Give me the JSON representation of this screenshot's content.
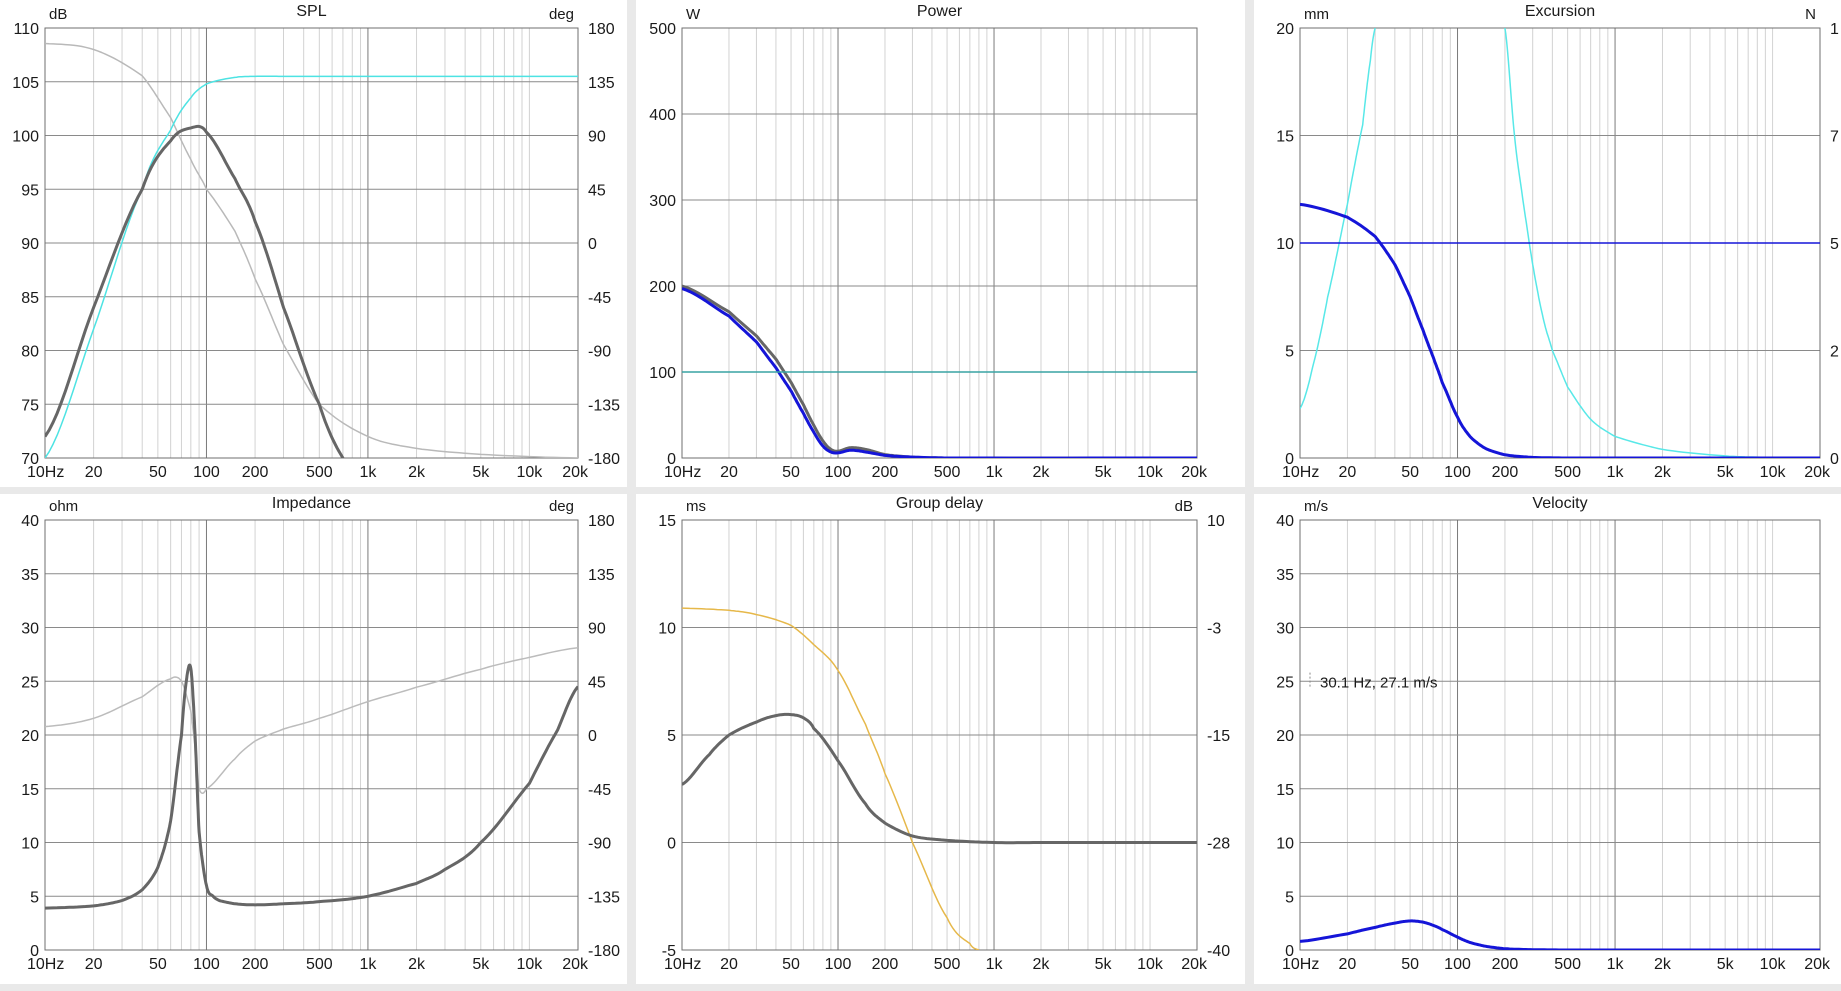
{
  "x_ticks": [
    "10Hz",
    "20",
    "50",
    "100",
    "200",
    "500",
    "1k",
    "2k",
    "5k",
    "10k",
    "20k"
  ],
  "x_range_hz": [
    10,
    20000
  ],
  "chart_data": [
    {
      "id": "spl",
      "type": "line",
      "title": "SPL",
      "left_unit": "dB",
      "right_unit": "deg",
      "ylim": [
        70,
        110
      ],
      "ylim_right": [
        -180,
        180
      ],
      "yticks_left": [
        "70",
        "75",
        "80",
        "85",
        "90",
        "95",
        "100",
        "105",
        "110"
      ],
      "yticks_right": [
        "-180",
        "-135",
        "-90",
        "-45",
        "0",
        "45",
        "90",
        "135",
        "180"
      ],
      "series": [
        {
          "axis": "right",
          "color": "#b9b9b9",
          "x": [
            10,
            20,
            40,
            60,
            80,
            100,
            150,
            200,
            300,
            500,
            1000,
            2000,
            5000,
            20000
          ],
          "y": [
            167,
            162,
            140,
            105,
            70,
            45,
            10,
            -30,
            -85,
            -135,
            -162,
            -172,
            -177,
            -180
          ]
        },
        {
          "axis": "left",
          "color": "#4de3e3",
          "x": [
            10,
            20,
            40,
            60,
            80,
            100,
            150,
            200,
            300,
            500,
            1000,
            5000,
            20000
          ],
          "y": [
            70,
            82,
            95,
            100.5,
            103.5,
            104.8,
            105.4,
            105.5,
            105.5,
            105.5,
            105.5,
            105.5,
            105.5
          ]
        },
        {
          "axis": "left",
          "color": "#666666",
          "x": [
            10,
            20,
            40,
            60,
            80,
            100,
            150,
            200,
            300,
            500,
            700,
            800
          ],
          "y": [
            72,
            84,
            95,
            99.5,
            100.7,
            100.3,
            96,
            92,
            84,
            75,
            70,
            68
          ]
        }
      ]
    },
    {
      "id": "power",
      "type": "line",
      "title": "Power",
      "left_unit": "W",
      "right_unit": "",
      "ylim": [
        0,
        500
      ],
      "yticks_left": [
        "0",
        "100",
        "200",
        "300",
        "400",
        "500"
      ],
      "series": [
        {
          "axis": "left",
          "color": "#666666",
          "x": [
            10,
            20,
            30,
            40,
            50,
            60,
            70,
            80,
            90,
            100,
            120,
            150,
            200,
            300,
            500,
            20000
          ],
          "y": [
            200,
            170,
            142,
            115,
            88,
            62,
            38,
            20,
            10,
            8,
            12,
            10,
            4,
            1,
            0,
            0
          ]
        },
        {
          "axis": "left",
          "color": "#1515d8",
          "x": [
            10,
            20,
            30,
            40,
            50,
            60,
            70,
            80,
            90,
            100,
            120,
            150,
            200,
            300,
            500,
            20000
          ],
          "y": [
            197,
            165,
            135,
            105,
            78,
            52,
            30,
            14,
            7,
            6,
            9,
            7,
            3,
            1,
            0,
            0
          ]
        },
        {
          "axis": "left",
          "color": "#38a4a4",
          "x": [
            10,
            20000
          ],
          "y": [
            100,
            100
          ]
        }
      ]
    },
    {
      "id": "excursion",
      "type": "line",
      "title": "Excursion",
      "left_unit": "mm",
      "right_unit": "N",
      "ylim": [
        0,
        20
      ],
      "yticks_left": [
        "0",
        "5",
        "10",
        "15",
        "20"
      ],
      "yticks_right": [
        "0",
        "2",
        "5",
        "7",
        "1"
      ],
      "series": [
        {
          "axis": "left",
          "color": "#58e8e8",
          "x": [
            10,
            12,
            15,
            20,
            25,
            28,
            30
          ],
          "y": [
            2.3,
            4.2,
            7.5,
            11.8,
            15.5,
            18.5,
            20
          ]
        },
        {
          "axis": "left",
          "color": "#58e8e8",
          "x": [
            200,
            230,
            260,
            300,
            350,
            400,
            500,
            700,
            1000,
            2000,
            5000,
            10000,
            20000
          ],
          "y": [
            20,
            15,
            12,
            9,
            6.5,
            5,
            3.3,
            1.8,
            1,
            0.4,
            0.1,
            0.03,
            0
          ]
        },
        {
          "axis": "left",
          "color": "#1515d8",
          "x": [
            10,
            20,
            30,
            40,
            50,
            60,
            70,
            80,
            100,
            120,
            150,
            200,
            300,
            500,
            20000
          ],
          "y": [
            11.8,
            11.2,
            10.3,
            9,
            7.5,
            6,
            4.7,
            3.5,
            1.9,
            1,
            0.45,
            0.15,
            0.03,
            0,
            0
          ]
        },
        {
          "axis": "left",
          "color": "#1515d8",
          "x": [
            10,
            20000
          ],
          "y": [
            10,
            10
          ]
        }
      ]
    },
    {
      "id": "impedance",
      "type": "line",
      "title": "Impedance",
      "left_unit": "ohm",
      "right_unit": "deg",
      "ylim": [
        0,
        40
      ],
      "ylim_right": [
        -180,
        180
      ],
      "yticks_left": [
        "0",
        "5",
        "10",
        "15",
        "20",
        "25",
        "30",
        "35",
        "40"
      ],
      "yticks_right": [
        "-180",
        "-135",
        "-90",
        "-45",
        "0",
        "45",
        "90",
        "135",
        "180"
      ],
      "series": [
        {
          "axis": "right",
          "color": "#bcbcbc",
          "x": [
            10,
            20,
            40,
            60,
            70,
            80,
            85,
            90,
            100,
            150,
            200,
            300,
            500,
            1000,
            2000,
            5000,
            10000,
            20000
          ],
          "y": [
            7,
            14,
            32,
            47,
            45,
            20,
            -10,
            -45,
            -45,
            -20,
            -5,
            5,
            14,
            28,
            40,
            55,
            65,
            73
          ]
        },
        {
          "axis": "left",
          "color": "#666666",
          "x": [
            10,
            20,
            30,
            40,
            50,
            60,
            70,
            75,
            80,
            85,
            90,
            100,
            110,
            120,
            150,
            200,
            300,
            500,
            1000,
            2000,
            3000,
            5000,
            10000,
            15000,
            20000
          ],
          "y": [
            3.9,
            4.1,
            4.6,
            5.6,
            7.7,
            12,
            20,
            25,
            26.2,
            20,
            11,
            6,
            5,
            4.6,
            4.3,
            4.2,
            4.3,
            4.5,
            5,
            6.2,
            7.5,
            10,
            15.5,
            20.5,
            24.5
          ]
        }
      ]
    },
    {
      "id": "group_delay",
      "type": "line",
      "title": "Group delay",
      "left_unit": "ms",
      "right_unit": "dB",
      "ylim": [
        -5,
        15
      ],
      "yticks_left": [
        "-5",
        "0",
        "5",
        "10",
        "15"
      ],
      "yticks_right": [
        "-40",
        "-28",
        "-15",
        "-3",
        "10"
      ],
      "series": [
        {
          "axis": "left",
          "color": "#e6b84a",
          "x": [
            10,
            20,
            30,
            50,
            70,
            100,
            150,
            200,
            300,
            500,
            700,
            800
          ],
          "y": [
            10.9,
            10.8,
            10.6,
            10.1,
            9.2,
            8,
            5.5,
            3.2,
            0,
            -3.5,
            -4.7,
            -5
          ]
        },
        {
          "axis": "left",
          "color": "#666666",
          "x": [
            10,
            15,
            20,
            30,
            40,
            50,
            60,
            70,
            100,
            150,
            200,
            300,
            500,
            1000,
            2000,
            20000
          ],
          "y": [
            2.7,
            4.1,
            5,
            5.6,
            5.9,
            5.95,
            5.8,
            5.3,
            3.8,
            1.8,
            0.9,
            0.3,
            0.1,
            0,
            0,
            0
          ]
        }
      ]
    },
    {
      "id": "velocity",
      "type": "line",
      "title": "Velocity",
      "left_unit": "m/s",
      "right_unit": "",
      "ylim": [
        0,
        40
      ],
      "yticks_left": [
        "0",
        "5",
        "10",
        "15",
        "20",
        "25",
        "30",
        "35",
        "40"
      ],
      "annotation": "30.1 Hz, 27.1 m/s",
      "series": [
        {
          "axis": "left",
          "color": "#1515d8",
          "x": [
            10,
            20,
            30,
            40,
            50,
            60,
            70,
            80,
            100,
            120,
            150,
            200,
            300,
            500,
            20000
          ],
          "y": [
            0.8,
            1.5,
            2.1,
            2.5,
            2.7,
            2.6,
            2.3,
            1.9,
            1.2,
            0.7,
            0.35,
            0.12,
            0.03,
            0,
            0
          ]
        }
      ]
    }
  ]
}
